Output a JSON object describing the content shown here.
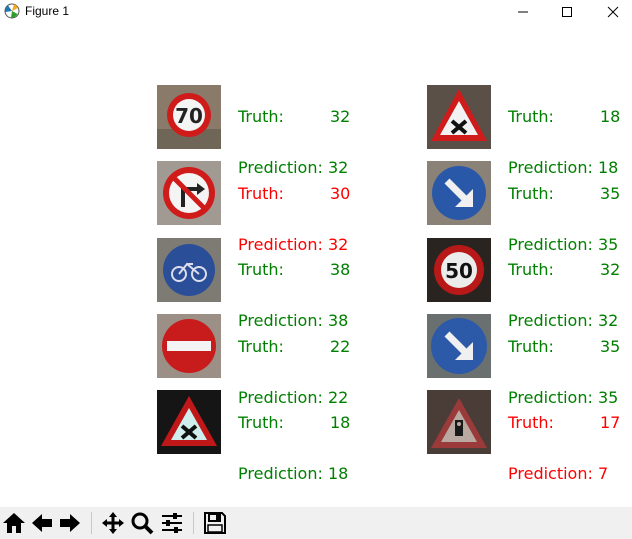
{
  "window": {
    "title": "Figure 1"
  },
  "colors": {
    "correct": "#008000",
    "incorrect": "#ff0000",
    "toolbar_bg": "#f0f0f0"
  },
  "predictions": [
    {
      "truth": "32",
      "prediction": "32",
      "correct": true,
      "sign": "speed-limit-70-sign"
    },
    {
      "truth": "18",
      "prediction": "18",
      "correct": true,
      "sign": "crossroads-warning-sign"
    },
    {
      "truth": "30",
      "prediction": "32",
      "correct": false,
      "sign": "no-right-turn-sign"
    },
    {
      "truth": "35",
      "prediction": "35",
      "correct": true,
      "sign": "keep-right-sign"
    },
    {
      "truth": "38",
      "prediction": "38",
      "correct": true,
      "sign": "cycle-path-sign"
    },
    {
      "truth": "32",
      "prediction": "32",
      "correct": true,
      "sign": "speed-limit-50-sign"
    },
    {
      "truth": "22",
      "prediction": "22",
      "correct": true,
      "sign": "no-entry-sign"
    },
    {
      "truth": "35",
      "prediction": "35",
      "correct": true,
      "sign": "keep-right-sign"
    },
    {
      "truth": "18",
      "prediction": "18",
      "correct": true,
      "sign": "crossroads-warning-sign"
    },
    {
      "truth": "17",
      "prediction": "7",
      "correct": false,
      "sign": "traffic-signals-warning-sign"
    }
  ],
  "labels": {
    "truth": "Truth:",
    "prediction": "Prediction:"
  },
  "toolbar": {
    "icons": [
      "home-icon",
      "back-icon",
      "forward-icon",
      "pan-icon",
      "zoom-icon",
      "configure-subplots-icon",
      "save-icon"
    ]
  }
}
